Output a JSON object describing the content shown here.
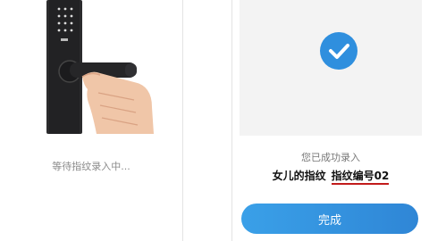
{
  "left": {
    "status_text": "等待指纹录入中..."
  },
  "right": {
    "success_text": "您已成功录入",
    "fingerprint_owner": "女儿的指纹",
    "fingerprint_number": "指纹编号02",
    "done_button": "完成"
  },
  "icons": {
    "success": "checkmark-icon",
    "lock": "smart-lock-illustration"
  },
  "colors": {
    "accent": "#2f8fde",
    "underline": "#c21b1b"
  }
}
